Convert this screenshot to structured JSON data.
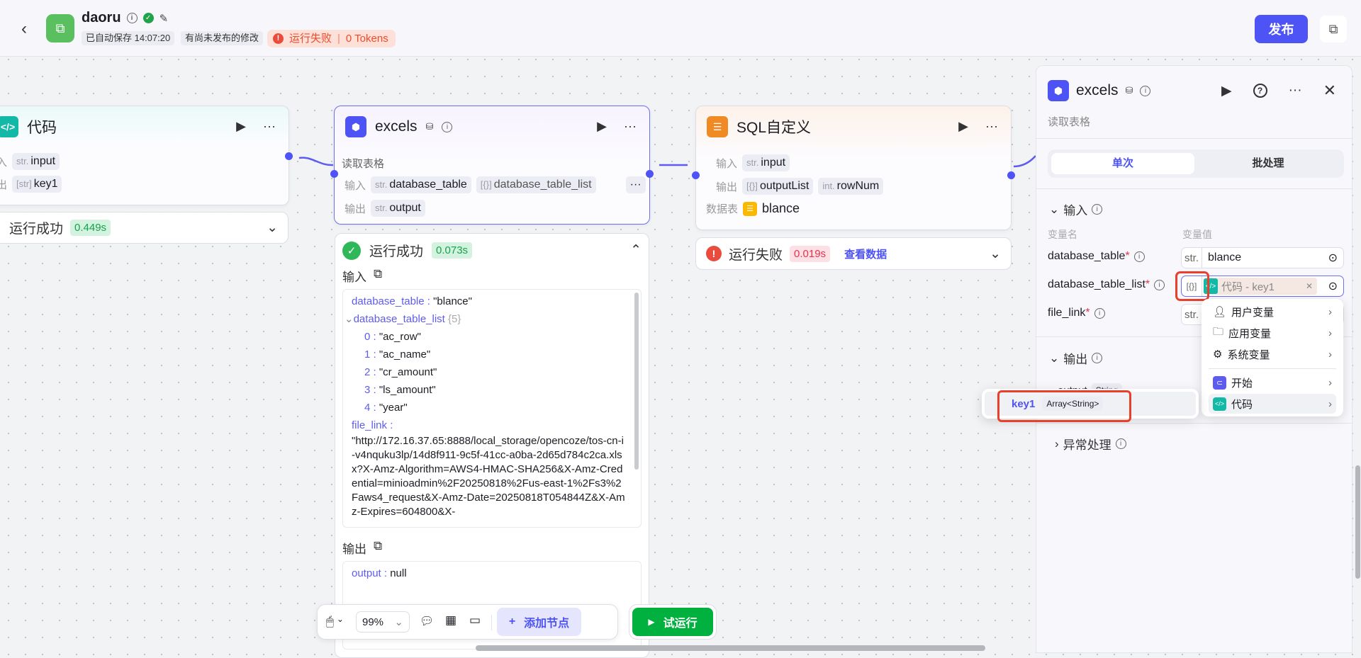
{
  "header": {
    "title": "daoru",
    "autosave": "已自动保存 14:07:20",
    "unpublished": "有尚未发布的修改",
    "run_status": "运行失败",
    "tokens": "0 Tokens",
    "publish": "发布"
  },
  "nodes": {
    "code": {
      "title": "代码",
      "in_label": "入",
      "out_label": "出",
      "input_type": "str.",
      "input": "input",
      "output_type": "[str]",
      "output": "key1",
      "status": "运行成功",
      "time": "0.449s"
    },
    "excels": {
      "title": "excels",
      "desc": "读取表格",
      "in_label": "输入",
      "out_label": "输出",
      "inputs": [
        {
          "type": "str.",
          "name": "database_table"
        },
        {
          "type": "[{}]",
          "name": "database_table_list"
        }
      ],
      "more": "···",
      "output_type": "str.",
      "output": "output",
      "status": "运行成功",
      "time": "0.073s",
      "result": {
        "input_label": "输入",
        "output_label": "输出",
        "database_table_key": "database_table :",
        "database_table_val": "\"blance\"",
        "list_key": "database_table_list",
        "list_count": "{5}",
        "list": [
          {
            "i": "0 :",
            "v": "\"ac_row\""
          },
          {
            "i": "1 :",
            "v": "\"ac_name\""
          },
          {
            "i": "2 :",
            "v": "\"cr_amount\""
          },
          {
            "i": "3 :",
            "v": "\"ls_amount\""
          },
          {
            "i": "4 :",
            "v": "\"year\""
          }
        ],
        "file_link_key": "file_link :",
        "file_link_val": "\"http://172.16.37.65:8888/local_storage/opencoze/tos-cn-i-v4nquku3lp/14d8f911-9c5f-41cc-a0ba-2d65d784c2ca.xlsx?X-Amz-Algorithm=AWS4-HMAC-SHA256&X-Amz-Credential=minioadmin%2F20250818%2Fus-east-1%2Fs3%2Faws4_request&X-Amz-Date=20250818T054844Z&X-Amz-Expires=604800&X-",
        "output_key": "output :",
        "output_val": "null"
      }
    },
    "sql": {
      "title": "SQL自定义",
      "in_label": "输入",
      "out_label": "输出",
      "table_label": "数据表",
      "input_type": "str.",
      "input": "input",
      "outputs": [
        {
          "type": "[{}]",
          "name": "outputList"
        },
        {
          "type": "int.",
          "name": "rowNum"
        }
      ],
      "table": "blance",
      "status": "运行失败",
      "time": "0.019s",
      "view_data": "查看数据"
    }
  },
  "panel": {
    "title": "excels",
    "desc": "读取表格",
    "tabs": [
      "单次",
      "批处理"
    ],
    "input_section": "输入",
    "col_name": "变量名",
    "col_value": "变量值",
    "params": [
      {
        "name": "database_table",
        "type": "str.",
        "value": "blance"
      },
      {
        "name": "database_table_list",
        "type": "[{}]",
        "value": "代码 - key1"
      },
      {
        "name": "file_link",
        "type": "str.",
        "value": ""
      }
    ],
    "output_section": "输出",
    "output_name": "output",
    "output_type": "String",
    "error_section": "异常处理"
  },
  "var_menu": {
    "items": [
      "用户变量",
      "应用变量",
      "系统变量",
      "开始",
      "代码"
    ]
  },
  "var_submenu": {
    "name": "key1",
    "type": "Array<String>"
  },
  "toolbar": {
    "zoom": "99%",
    "add_node": "添加节点",
    "test_run": "试运行"
  },
  "colors": {
    "accent": "#4d53f5",
    "success": "#16a34a",
    "error": "#e5334b",
    "highlight": "#e8402a"
  }
}
